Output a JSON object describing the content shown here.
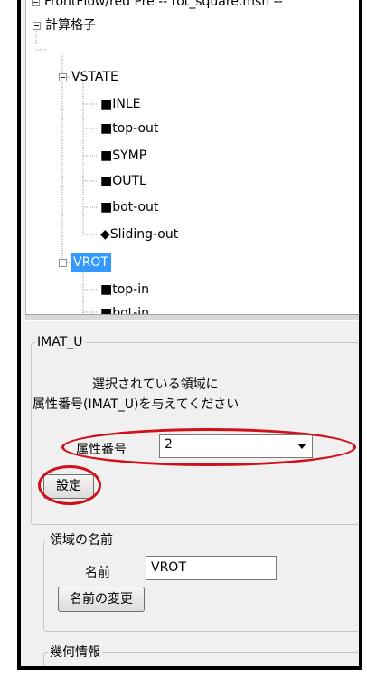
{
  "tree": {
    "root_label": "FrontFlow/red Pre -- rot_square.msh --",
    "grid_label": "計算格子",
    "groups": [
      {
        "label": "VSTATE",
        "children": [
          {
            "marker": "■",
            "label": "INLE"
          },
          {
            "marker": "■",
            "label": "top-out"
          },
          {
            "marker": "■",
            "label": "SYMP"
          },
          {
            "marker": "■",
            "label": "OUTL"
          },
          {
            "marker": "■",
            "label": "bot-out"
          },
          {
            "marker": "◆",
            "label": "Sliding-out"
          }
        ]
      },
      {
        "label": "VROT",
        "children": [
          {
            "marker": "■",
            "label": "top-in"
          },
          {
            "marker": "■",
            "label": "bot-in"
          }
        ]
      }
    ]
  },
  "imat_group": {
    "legend": "IMAT_U",
    "instruction_line1": "選択されている領域に",
    "instruction_line2": "属性番号(IMAT_U)を与えてください",
    "attr_label": "属性番号",
    "attr_value": "2",
    "set_button": "設定"
  },
  "name_group": {
    "legend": "領域の名前",
    "name_label": "名前",
    "name_value": "VROT",
    "rename_button": "名前の変更"
  },
  "geometry_group": {
    "legend": "幾何情報"
  },
  "colors": {
    "selection": "#3399ff",
    "highlight_ring": "#d0101a"
  }
}
